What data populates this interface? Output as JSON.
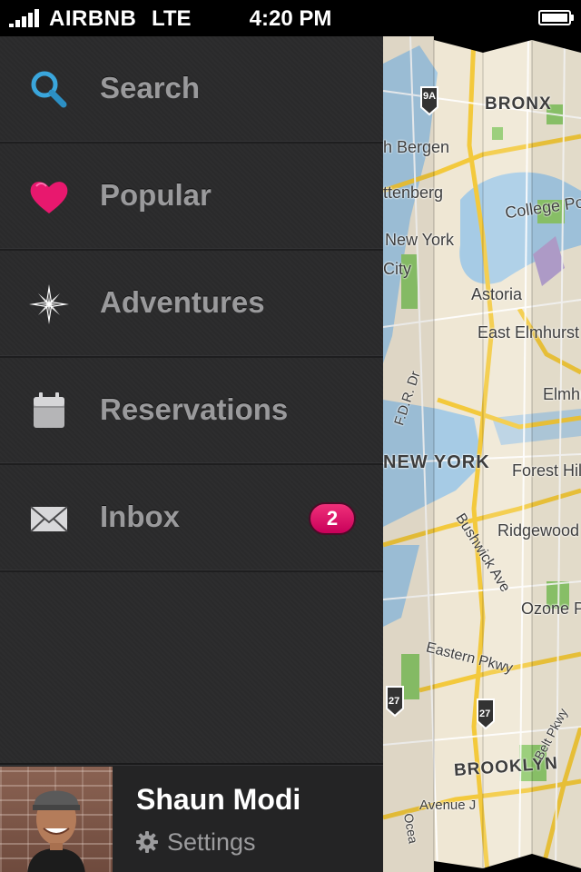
{
  "status_bar": {
    "carrier": "AIRBNB",
    "network": "LTE",
    "time": "4:20 PM"
  },
  "menu": {
    "items": [
      {
        "label": "Search",
        "icon": "search-icon"
      },
      {
        "label": "Popular",
        "icon": "heart-icon"
      },
      {
        "label": "Adventures",
        "icon": "compass-icon"
      },
      {
        "label": "Reservations",
        "icon": "calendar-icon"
      },
      {
        "label": "Inbox",
        "icon": "envelope-icon",
        "badge": "2"
      }
    ]
  },
  "profile": {
    "name": "Shaun Modi",
    "settings_label": "Settings"
  },
  "map": {
    "labels": [
      "BRONX",
      "9A",
      "h Bergen",
      "ttenberg",
      "College Poi",
      "New York",
      "City",
      "Astoria",
      "East Elmhurst",
      "Elmhu",
      "F.D.R. Dr",
      "NEW YORK",
      "Forest Hills",
      "Bushwick Ave",
      "Ridgewood",
      "Ozone Par",
      "Eastern Pkwy",
      "27",
      "27",
      "BROOKLYN",
      "Avenue J",
      "Belt Pkwy",
      "Ocea"
    ]
  },
  "colors": {
    "accent_pink": "#e8186e",
    "search_blue": "#3aa6dc",
    "menu_bg": "#2b2b2c",
    "map_water": "#a6cbe5",
    "map_road": "#f3c93c",
    "map_park": "#8fc96c"
  }
}
